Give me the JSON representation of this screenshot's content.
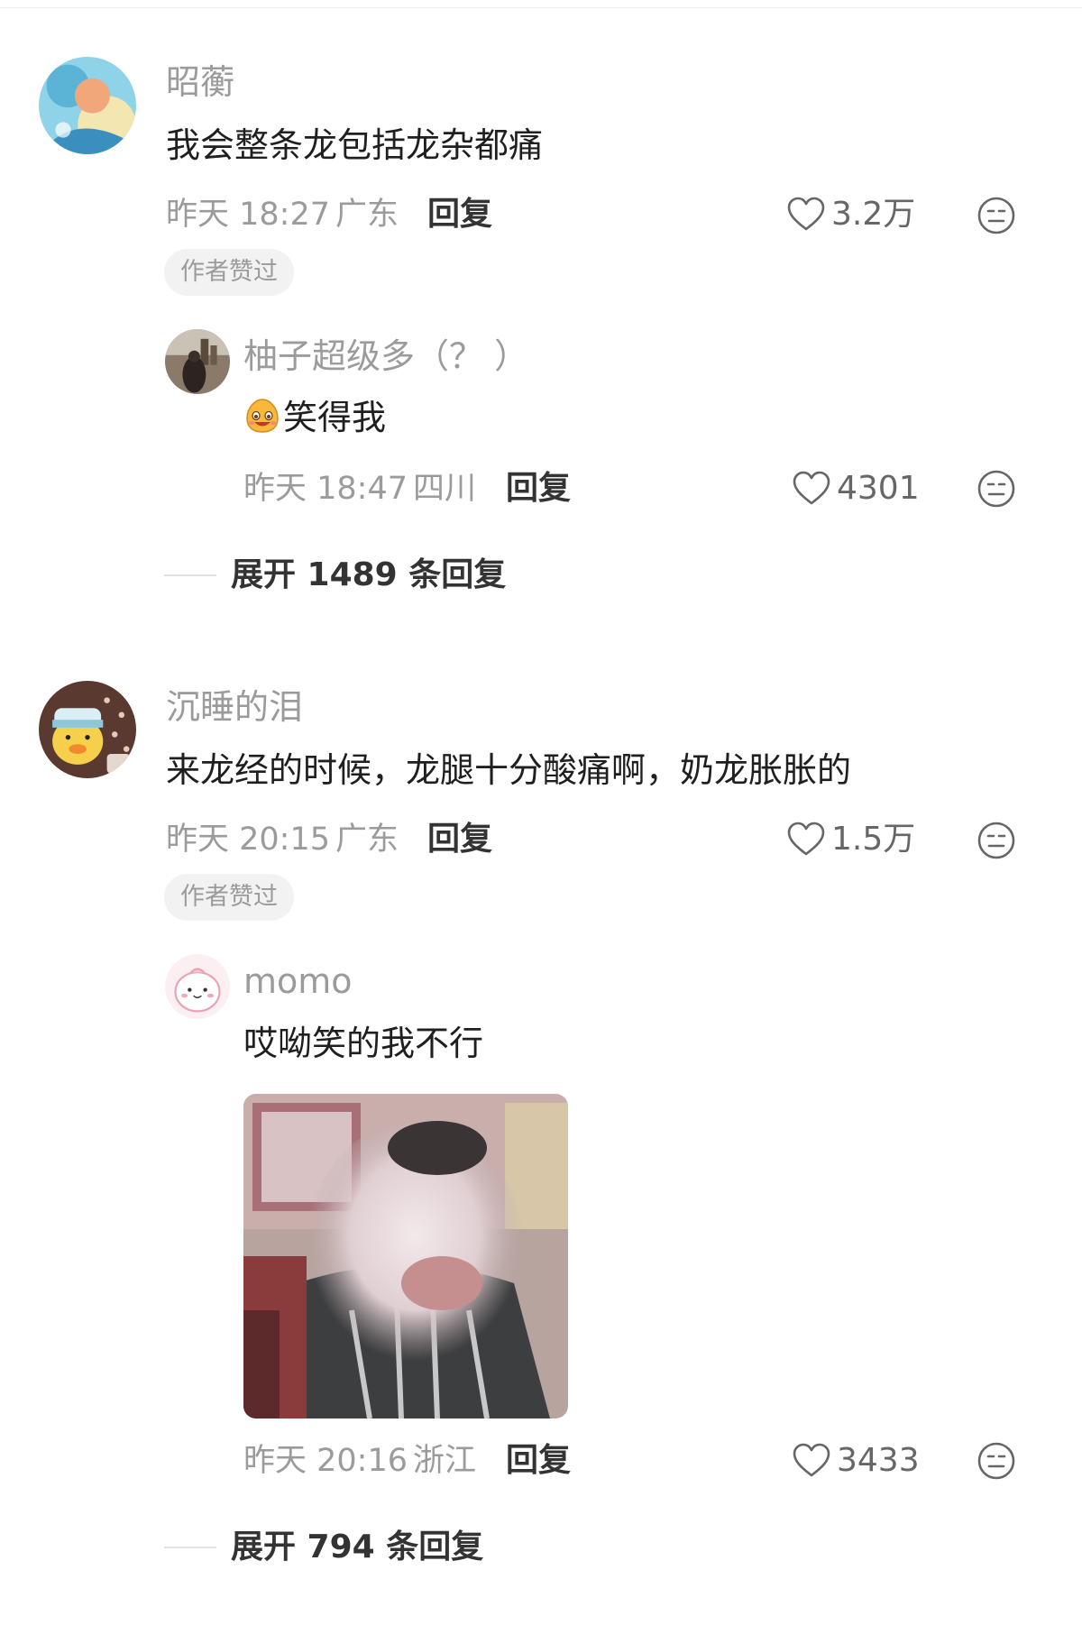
{
  "comments": [
    {
      "username": "昭蘅",
      "text": "我会整条龙包括龙杂都痛",
      "time": "昨天 18:27",
      "location": "广东",
      "reply_label": "回复",
      "likes": "3.2万",
      "badge": "作者赞过",
      "replies": [
        {
          "username": "柚子超级多（？ ）",
          "text": "笑得我",
          "time": "昨天 18:47",
          "location": "四川",
          "reply_label": "回复",
          "likes": "4301"
        }
      ],
      "expand_label": "展开 1489 条回复"
    },
    {
      "username": "沉睡的泪",
      "text": "来龙经的时候，龙腿十分酸痛啊，奶龙胀胀的",
      "time": "昨天 20:15",
      "location": "广东",
      "reply_label": "回复",
      "likes": "1.5万",
      "badge": "作者赞过",
      "replies": [
        {
          "username": "momo",
          "text": "哎呦笑的我不行",
          "time": "昨天 20:16",
          "location": "浙江",
          "reply_label": "回复",
          "likes": "3433"
        }
      ],
      "expand_label": "展开 794 条回复"
    }
  ],
  "colors": {
    "secondary_text": "#9b9b9b",
    "primary_text": "#1f1f1f",
    "badge_bg": "#f2f2f2"
  },
  "icons": {
    "like": "heart-outline-icon",
    "react": "meh-face-icon",
    "laugh_emoji": "laughing-emoji"
  }
}
